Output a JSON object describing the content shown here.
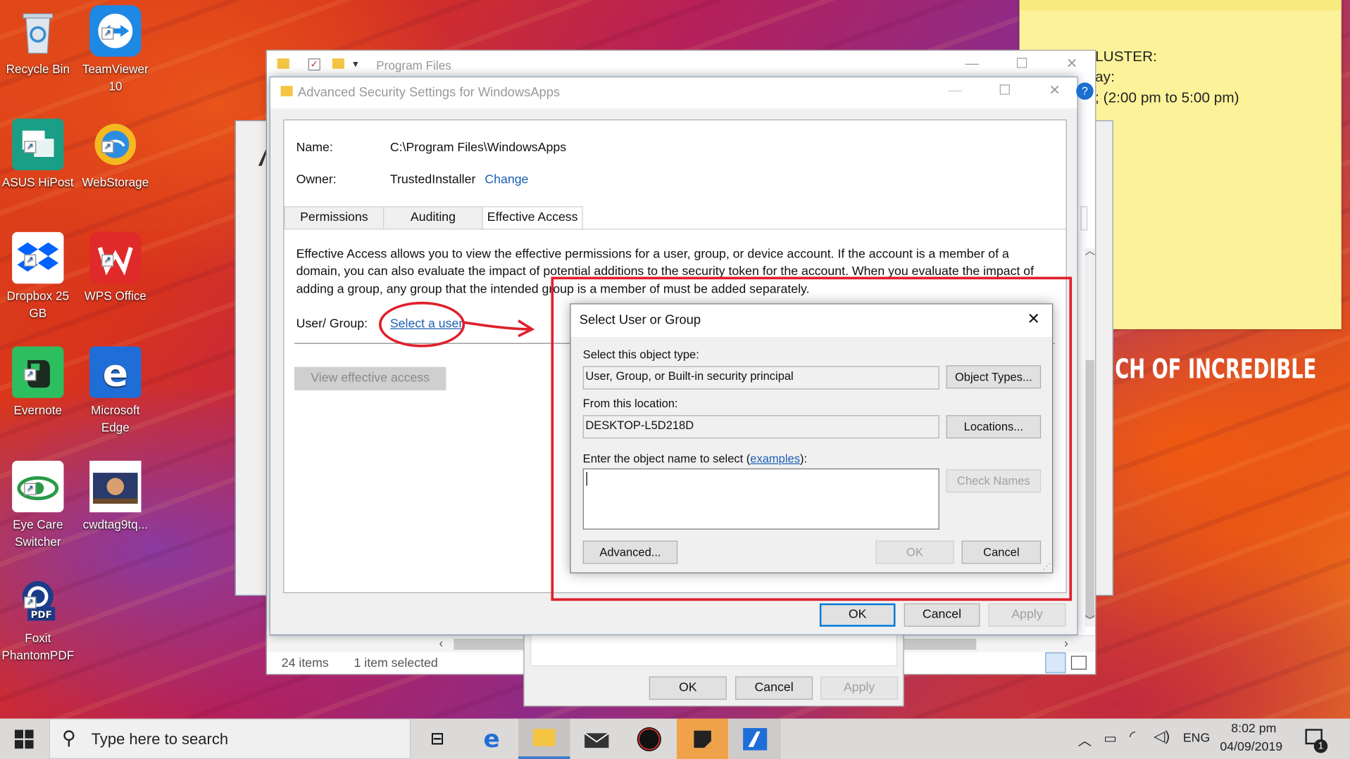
{
  "desktop": {
    "icons": [
      {
        "label": "Recycle Bin",
        "icon": "recycle-bin-icon"
      },
      {
        "label": "TeamViewer 10",
        "icon": "teamviewer-icon"
      },
      {
        "label": "ASUS HiPost",
        "icon": "asus-hipost-icon"
      },
      {
        "label": "WebStorage",
        "icon": "webstorage-icon"
      },
      {
        "label": "Dropbox 25 GB",
        "icon": "dropbox-icon"
      },
      {
        "label": "WPS Office",
        "icon": "wps-office-icon"
      },
      {
        "label": "Evernote",
        "icon": "evernote-icon"
      },
      {
        "label": "Microsoft Edge",
        "icon": "edge-icon"
      },
      {
        "label": "Eye Care Switcher",
        "icon": "eye-care-icon"
      },
      {
        "label": "cwdtag9tq...",
        "icon": "image-file-icon"
      },
      {
        "label": "Foxit PhantomPDF",
        "icon": "foxit-icon"
      }
    ],
    "sticky_note": {
      "lines": [
        "LUSTER:",
        "ay:",
        "; (2:00 pm to 5:00 pm)"
      ]
    },
    "wallpaper_text": "CH OF INCREDIBLE",
    "notification_badge": "?"
  },
  "explorer": {
    "title": "Program Files",
    "status_items": "24 items",
    "status_selected": "1 item selected"
  },
  "advanced_security": {
    "title": "Advanced Security Settings for WindowsApps",
    "name_label": "Name:",
    "name_value": "C:\\Program Files\\WindowsApps",
    "owner_label": "Owner:",
    "owner_value": "TrustedInstaller",
    "owner_change": "Change",
    "tabs": [
      "Permissions",
      "Auditing",
      "Effective Access"
    ],
    "description_lines": [
      "Effective Access allows you to view the effective permissions for a user, group, or device account. If the account is a member of a",
      "domain, you can also evaluate the impact of potential additions to the security token for the account. When you evaluate the impact of",
      "adding a group, any group that the intended group is a member of must be added separately."
    ],
    "user_group_label": "User/ Group:",
    "select_user_link": "Select a user",
    "view_effective_access": "View effective access",
    "ok": "OK",
    "cancel": "Cancel",
    "apply": "Apply"
  },
  "properties_dialog": {
    "ok": "OK",
    "cancel": "Cancel",
    "apply": "Apply"
  },
  "select_user_dialog": {
    "title": "Select User or Group",
    "object_type_label": "Select this object type:",
    "object_type_value": "User, Group, or Built-in security principal",
    "object_types_button": "Object Types...",
    "location_label": "From this location:",
    "location_value": "DESKTOP-L5D218D",
    "locations_button": "Locations...",
    "enter_name_label_prefix": "Enter the object name to select (",
    "examples_link": "examples",
    "enter_name_label_suffix": "):",
    "object_name_value": "",
    "check_names_button": "Check Names",
    "advanced_button": "Advanced...",
    "ok_button": "OK",
    "cancel_button": "Cancel"
  },
  "taskbar": {
    "search_placeholder": "Type here to search",
    "language": "ENG",
    "time": "8:02 pm",
    "date": "04/09/2019",
    "notification_count": "1"
  },
  "colors": {
    "annotation_red": "#e0202c",
    "link_blue": "#1a5fb4",
    "accent": "#0078d7"
  }
}
